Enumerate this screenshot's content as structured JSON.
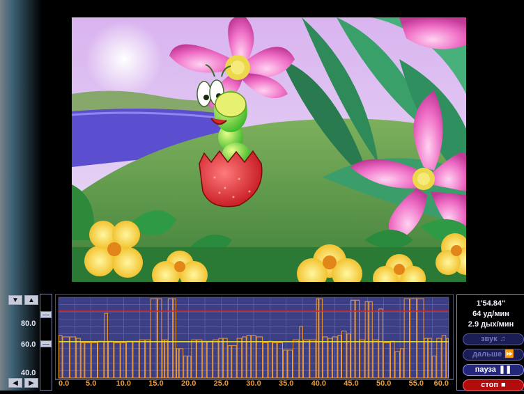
{
  "colors": {
    "chart_bg": "#3d3f85",
    "chart_grid": "#6a6db0",
    "bar": "#f29a2e",
    "upper_line": "#c42a2a",
    "lower_line": "#e8e020",
    "tick": "#f29a2e"
  },
  "vertical_controls": {
    "up_icon": "triangle-up-icon",
    "down_icon": "triangle-down-icon"
  },
  "horizontal_controls": {
    "left_icon": "triangle-left-icon",
    "right_icon": "triangle-right-icon"
  },
  "y_axis": {
    "labels": [
      "80.0",
      "60.0",
      "40.0"
    ]
  },
  "thresholds": {
    "upper": 85.6,
    "lower": 64.7
  },
  "chart_data": {
    "type": "bar",
    "x_ticks": [
      "0.0",
      "5.0",
      "10.0",
      "15.0",
      "20.0",
      "25.0",
      "30.0",
      "35.0",
      "40.0",
      "45.0",
      "50.0",
      "55.0",
      "60.0"
    ],
    "xlim": [
      0,
      60
    ],
    "ylim": [
      40,
      95
    ],
    "reference_lines": [
      85.6,
      64.7
    ],
    "values": [
      {
        "x": 0.0,
        "y": 69
      },
      {
        "x": 0.6,
        "y": 68
      },
      {
        "x": 1.7,
        "y": 68
      },
      {
        "x": 2.7,
        "y": 67
      },
      {
        "x": 3.4,
        "y": 64
      },
      {
        "x": 4.0,
        "y": 64
      },
      {
        "x": 5.0,
        "y": 64
      },
      {
        "x": 6.0,
        "y": 65
      },
      {
        "x": 7.0,
        "y": 84
      },
      {
        "x": 7.6,
        "y": 65
      },
      {
        "x": 8.5,
        "y": 64
      },
      {
        "x": 9.5,
        "y": 64
      },
      {
        "x": 10.4,
        "y": 65
      },
      {
        "x": 11.4,
        "y": 65
      },
      {
        "x": 12.4,
        "y": 66
      },
      {
        "x": 13.3,
        "y": 66
      },
      {
        "x": 14.1,
        "y": 94
      },
      {
        "x": 15.2,
        "y": 94
      },
      {
        "x": 15.9,
        "y": 66
      },
      {
        "x": 16.3,
        "y": 66
      },
      {
        "x": 16.8,
        "y": 94
      },
      {
        "x": 17.6,
        "y": 94
      },
      {
        "x": 18.1,
        "y": 60
      },
      {
        "x": 18.5,
        "y": 60
      },
      {
        "x": 19.2,
        "y": 55
      },
      {
        "x": 19.8,
        "y": 55
      },
      {
        "x": 20.4,
        "y": 66
      },
      {
        "x": 21.2,
        "y": 66
      },
      {
        "x": 22.1,
        "y": 65
      },
      {
        "x": 22.8,
        "y": 65
      },
      {
        "x": 23.7,
        "y": 66
      },
      {
        "x": 24.6,
        "y": 67
      },
      {
        "x": 25.3,
        "y": 67
      },
      {
        "x": 26.0,
        "y": 62
      },
      {
        "x": 26.6,
        "y": 62
      },
      {
        "x": 27.4,
        "y": 67
      },
      {
        "x": 28.2,
        "y": 68
      },
      {
        "x": 28.9,
        "y": 69
      },
      {
        "x": 29.6,
        "y": 69
      },
      {
        "x": 30.4,
        "y": 68
      },
      {
        "x": 31.4,
        "y": 64
      },
      {
        "x": 32.2,
        "y": 65
      },
      {
        "x": 32.9,
        "y": 64
      },
      {
        "x": 33.6,
        "y": 64
      },
      {
        "x": 34.5,
        "y": 59
      },
      {
        "x": 35.2,
        "y": 59
      },
      {
        "x": 36.0,
        "y": 66
      },
      {
        "x": 37.0,
        "y": 75
      },
      {
        "x": 37.6,
        "y": 66
      },
      {
        "x": 38.6,
        "y": 66
      },
      {
        "x": 39.6,
        "y": 94
      },
      {
        "x": 40.0,
        "y": 94
      },
      {
        "x": 40.6,
        "y": 68
      },
      {
        "x": 41.4,
        "y": 67
      },
      {
        "x": 42.1,
        "y": 68
      },
      {
        "x": 42.9,
        "y": 69
      },
      {
        "x": 43.5,
        "y": 72
      },
      {
        "x": 44.3,
        "y": 70
      },
      {
        "x": 44.9,
        "y": 93
      },
      {
        "x": 45.6,
        "y": 93
      },
      {
        "x": 46.3,
        "y": 66
      },
      {
        "x": 47.1,
        "y": 92
      },
      {
        "x": 47.7,
        "y": 92
      },
      {
        "x": 48.3,
        "y": 66
      },
      {
        "x": 49.2,
        "y": 87
      },
      {
        "x": 49.9,
        "y": 64
      },
      {
        "x": 51.0,
        "y": 65
      },
      {
        "x": 51.7,
        "y": 58
      },
      {
        "x": 52.5,
        "y": 60
      },
      {
        "x": 53.1,
        "y": 94
      },
      {
        "x": 54.0,
        "y": 94
      },
      {
        "x": 55.1,
        "y": 94
      },
      {
        "x": 56.2,
        "y": 67
      },
      {
        "x": 56.8,
        "y": 67
      },
      {
        "x": 57.4,
        "y": 55
      },
      {
        "x": 58.1,
        "y": 67
      },
      {
        "x": 58.9,
        "y": 69
      },
      {
        "x": 59.6,
        "y": 67
      }
    ]
  },
  "stats": {
    "time": "1'54.84\"",
    "pulse": "64 уд/мин",
    "breath": "2.9 дых/мин"
  },
  "buttons": {
    "sound": {
      "label": "звук",
      "icon": "music-note-icon"
    },
    "next": {
      "label": "дальше",
      "icon": "fast-forward-icon"
    },
    "pause": {
      "label": "пауза",
      "icon": "pause-icon"
    },
    "stop": {
      "label": "стоп",
      "icon": "stop-square-icon"
    }
  }
}
